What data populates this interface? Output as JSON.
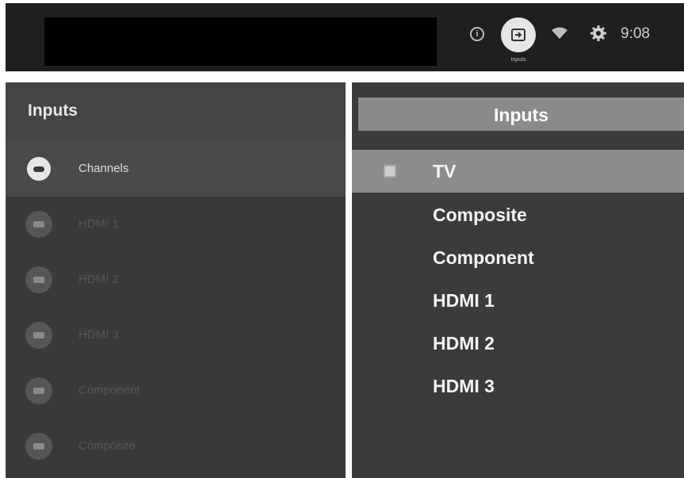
{
  "status_bar": {
    "icons": [
      "info-icon",
      "input-icon",
      "wifi-icon",
      "gear-icon"
    ],
    "input_label": "Inputs",
    "time": "9:08"
  },
  "left_menu": {
    "title": "Inputs",
    "items": [
      {
        "label": "Channels",
        "icon": "tv-icon",
        "selected": true
      },
      {
        "label": "HDMI 1",
        "icon": "hdmi-icon",
        "selected": false
      },
      {
        "label": "HDMI 2",
        "icon": "hdmi-icon",
        "selected": false
      },
      {
        "label": "HDMI 3",
        "icon": "hdmi-icon",
        "selected": false
      },
      {
        "label": "Component",
        "icon": "component-icon",
        "selected": false
      },
      {
        "label": "Composite",
        "icon": "composite-icon",
        "selected": false
      }
    ]
  },
  "right_menu": {
    "title": "Inputs",
    "items": [
      {
        "label": "TV",
        "selected": true
      },
      {
        "label": "Composite",
        "selected": false
      },
      {
        "label": "Component",
        "selected": false
      },
      {
        "label": "HDMI 1",
        "selected": false
      },
      {
        "label": "HDMI 2",
        "selected": false
      },
      {
        "label": "HDMI 3",
        "selected": false
      }
    ]
  },
  "colors": {
    "bar_bg": "#1f1f1f",
    "panel_bg": "#3a3a3a",
    "highlight": "#8c8c8c"
  }
}
